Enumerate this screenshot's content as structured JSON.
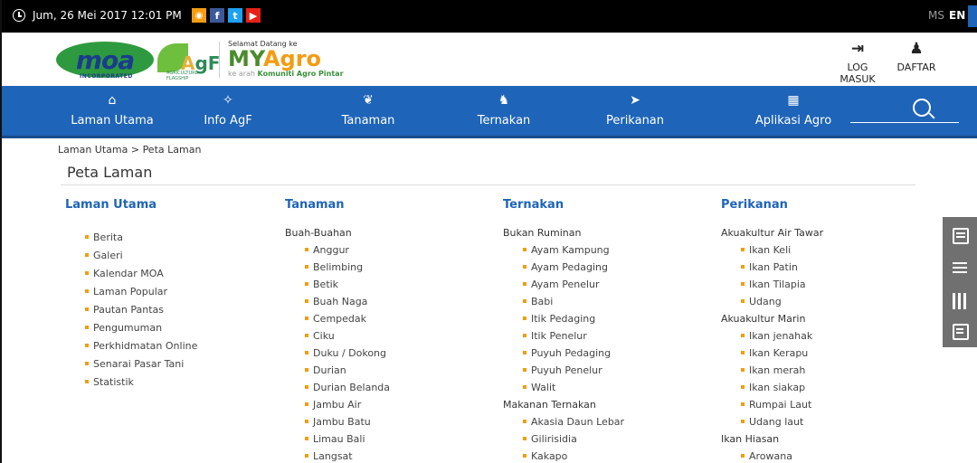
{
  "topbar": {
    "date": "Jum, 26 Mei 2017  12:01 PM",
    "languages": {
      "ms": "MS",
      "en": "EN"
    },
    "social": {
      "rss": "rss-icon",
      "facebook": "f",
      "twitter": "t",
      "youtube": "▶"
    }
  },
  "header": {
    "moa_text": "moa",
    "moa_sub": "INCORPORATED",
    "agf_small": "AGRICULTURE FLAGSHIP",
    "myagro_welcome": "Selamat Datang ke",
    "myagro_my": "MY",
    "myagro_agro": "Agro",
    "myagro_tag_pre": "ke arah",
    "myagro_tag_bold": "Komuniti Agro Pintar",
    "login_label": "LOG MASUK",
    "register_label": "DAFTAR"
  },
  "nav": {
    "items": [
      {
        "label": "Laman Utama",
        "icon": "home-icon"
      },
      {
        "label": "Info AgF",
        "icon": "agf-icon"
      },
      {
        "label": "Tanaman",
        "icon": "plant-icon"
      },
      {
        "label": "Ternakan",
        "icon": "cow-icon"
      },
      {
        "label": "Perikanan",
        "icon": "fish-icon"
      },
      {
        "label": "Aplikasi Agro",
        "icon": "apps-icon"
      }
    ]
  },
  "breadcrumb": "Laman Utama > Peta Laman",
  "page_title": "Peta Laman",
  "sitemap": {
    "laman_utama": {
      "heading": "Laman Utama",
      "items": [
        "Berita",
        "Galeri",
        "Kalendar MOA",
        "Laman Popular",
        "Pautan Pantas",
        "Pengumuman",
        "Perkhidmatan Online",
        "Senarai Pasar Tani",
        "Statistik"
      ]
    },
    "tanaman": {
      "heading": "Tanaman",
      "group": "Buah-Buahan",
      "items": [
        "Anggur",
        "Belimbing",
        "Betik",
        "Buah Naga",
        "Cempedak",
        "Ciku",
        "Duku / Dokong",
        "Durian",
        "Durian Belanda",
        "Jambu Air",
        "Jambu Batu",
        "Limau Bali",
        "Langsat"
      ]
    },
    "ternakan": {
      "heading": "Ternakan",
      "group1": "Bukan Ruminan",
      "items1": [
        "Ayam Kampung",
        "Ayam Pedaging",
        "Ayam Penelur",
        "Babi",
        "Itik Pedaging",
        "Itik Penelur",
        "Puyuh Pedaging",
        "Puyuh Penelur",
        "Walit"
      ],
      "group2": "Makanan Ternakan",
      "items2": [
        "Akasia Daun Lebar",
        "Gilirisidia",
        "Kakapo"
      ]
    },
    "perikanan": {
      "heading": "Perikanan",
      "group1": "Akuakultur Air Tawar",
      "items1": [
        "Ikan Keli",
        "Ikan Patin",
        "Ikan Tilapia",
        "Udang"
      ],
      "group2": "Akuakultur Marin",
      "items2": [
        "Ikan jenahak",
        "Ikan Kerapu",
        "Ikan merah",
        "Ikan siakap",
        "Rumpai Laut",
        "Udang laut"
      ],
      "group3": "Ikan Hiasan",
      "items3": [
        "Arowana"
      ]
    }
  },
  "colors": {
    "nav_blue": "#1e64b8",
    "bullet": "#f39c12",
    "heading": "#1e64b8"
  }
}
